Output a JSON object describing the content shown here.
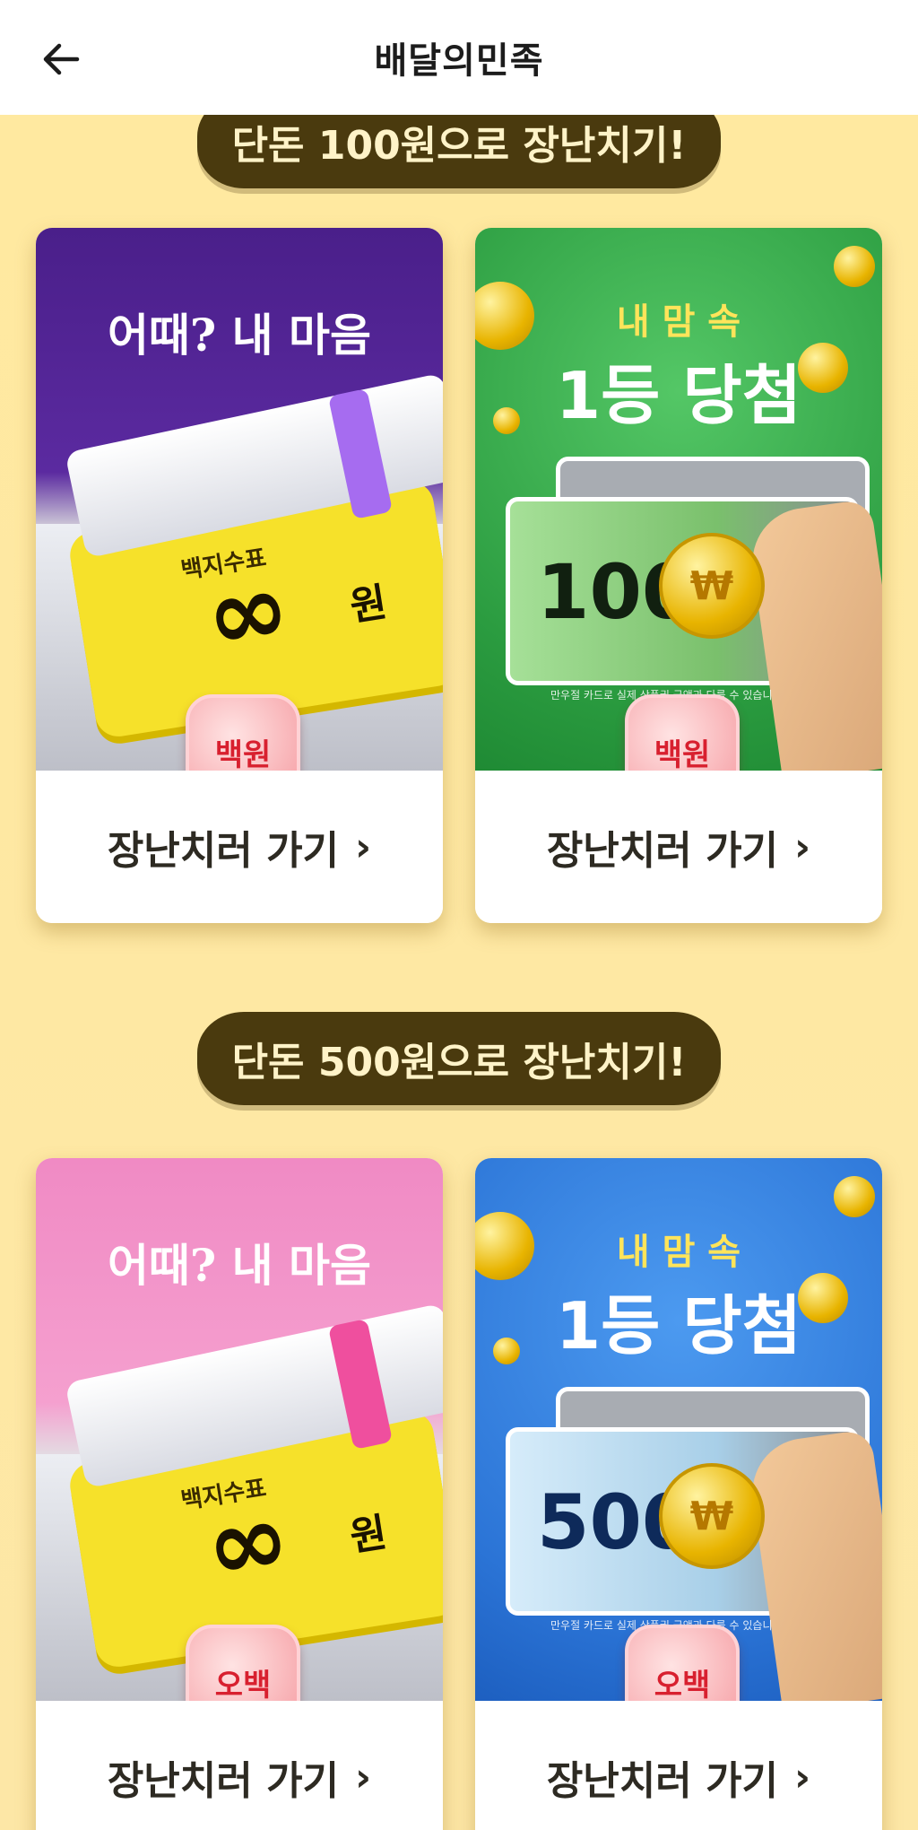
{
  "header": {
    "title": "배달의민족",
    "back_icon": "arrow-left-icon"
  },
  "sections": [
    {
      "heading": "단돈 100원으로 장난치기!",
      "cards": [
        {
          "theme": "purple",
          "headline": "어때? 내 마음",
          "ticket_label": "백지수표",
          "ticket_amount": "∞",
          "ticket_unit": "원",
          "badge": "백원",
          "cta": "장난치러 가기",
          "accent": "#5b2a9c"
        },
        {
          "theme": "green",
          "headline_top": "내 맘 속",
          "headline_main": "1등 당첨",
          "scratch_amount": "100",
          "coin_symbol": "₩",
          "disclaimer": "만우절 카드로 실제 상품권 금액과 다를 수 있습니",
          "badge": "백원",
          "cta": "장난치러 가기",
          "accent": "#2fa64a"
        }
      ]
    },
    {
      "heading": "단돈 500원으로 장난치기!",
      "cards": [
        {
          "theme": "pink",
          "headline": "어때? 내 마음",
          "ticket_label": "백지수표",
          "ticket_amount": "∞",
          "ticket_unit": "원",
          "badge": "오백",
          "cta": "장난치러 가기",
          "accent": "#f29ac7"
        },
        {
          "theme": "blue",
          "headline_top": "내 맘 속",
          "headline_main": "1등 당첨",
          "scratch_amount": "500",
          "coin_symbol": "₩",
          "disclaimer": "만우절 카드로 실제 상품권 금액과 다를 수 있습니",
          "badge": "오백",
          "cta": "장난치러 가기",
          "accent": "#2e78d8"
        }
      ]
    }
  ]
}
